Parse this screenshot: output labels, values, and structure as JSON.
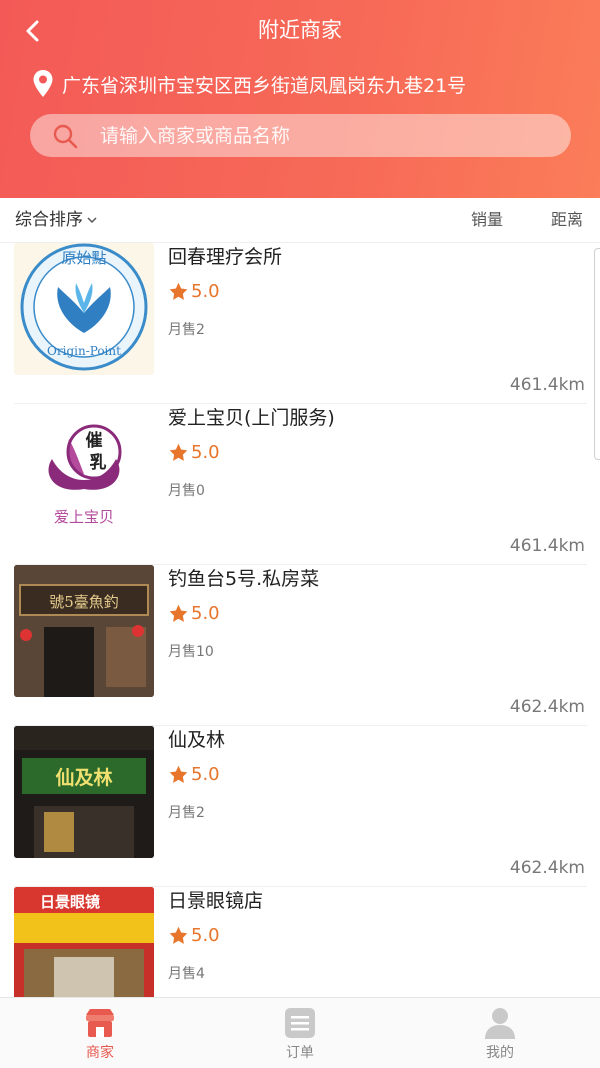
{
  "header": {
    "title": "附近商家",
    "location": "广东省深圳市宝安区西乡街道凤凰岗东九巷21号",
    "search_placeholder": "请输入商家或商品名称"
  },
  "sort": {
    "default_label": "综合排序",
    "sales_label": "销量",
    "distance_label": "距离"
  },
  "shops": [
    {
      "name": "回春理疗会所",
      "rating": "5.0",
      "monthly_sales": "月售2",
      "distance": "461.4km",
      "logo_text": "原始點",
      "logo_sub": "Origin-Point"
    },
    {
      "name": "爱上宝贝(上门服务)",
      "rating": "5.0",
      "monthly_sales": "月售0",
      "distance": "461.4km",
      "logo_text": "催乳",
      "logo_sub": "爱上宝贝"
    },
    {
      "name": "钓鱼台5号.私房菜",
      "rating": "5.0",
      "monthly_sales": "月售10",
      "distance": "462.4km",
      "logo_text": "號5臺魚釣"
    },
    {
      "name": "仙及林",
      "rating": "5.0",
      "monthly_sales": "月售2",
      "distance": "462.4km",
      "logo_text": "仙及林"
    },
    {
      "name": "日景眼镜店",
      "rating": "5.0",
      "monthly_sales": "月售4",
      "distance": "",
      "logo_text": "日景眼镜"
    }
  ],
  "tabs": [
    {
      "label": "商家",
      "icon": "store-icon",
      "active": true
    },
    {
      "label": "订单",
      "icon": "order-icon",
      "active": false
    },
    {
      "label": "我的",
      "icon": "profile-icon",
      "active": false
    }
  ],
  "colors": {
    "accent": "#f35a57",
    "rating": "#e8752c",
    "tab_active": "#e8594f"
  }
}
